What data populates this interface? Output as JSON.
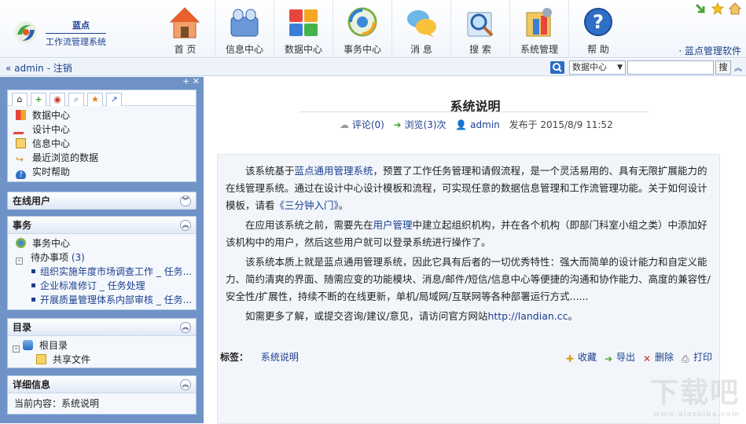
{
  "header": {
    "brand": "蓝点",
    "system_name": "工作流管理系统",
    "brand_link": "· 蓝点管理软件",
    "nav": [
      {
        "label": "首 页",
        "icon": "home-icon"
      },
      {
        "label": "信息中心",
        "icon": "info-center-icon"
      },
      {
        "label": "数据中心",
        "icon": "data-center-icon"
      },
      {
        "label": "事务中心",
        "icon": "task-center-icon"
      },
      {
        "label": "消 息",
        "icon": "message-icon"
      },
      {
        "label": "搜 索",
        "icon": "search-icon"
      },
      {
        "label": "系统管理",
        "icon": "system-admin-icon"
      },
      {
        "label": "帮 助",
        "icon": "help-icon"
      }
    ]
  },
  "toolbar": {
    "user": "admin",
    "logout": "注销",
    "search_scope": "数据中心",
    "search_value": "",
    "search_button": "搜"
  },
  "sidebar": {
    "quick_links": [
      {
        "label": "数据中心"
      },
      {
        "label": "设计中心"
      },
      {
        "label": "信息中心"
      },
      {
        "label": "最近浏览的数据"
      },
      {
        "label": "实时帮助"
      }
    ],
    "online_users": {
      "title": "在线用户"
    },
    "tasks": {
      "title": "事务",
      "center": "事务中心",
      "pending": "待办事项",
      "pending_count": "(3)",
      "items": [
        "组织实施年度市场调查工作 _ 任务...",
        "企业标准修订 _ 任务处理",
        "开展质量管理体系内部审核 _ 任务..."
      ]
    },
    "directory": {
      "title": "目录",
      "root": "根目录",
      "shared": "共享文件"
    },
    "details": {
      "title": "详细信息",
      "current": "当前内容：系统说明"
    }
  },
  "article": {
    "title": "系统说明",
    "comments": "评论(0)",
    "views": "浏览(3)次",
    "author": "admin",
    "published": "发布于 2015/8/9 11:52",
    "paragraphs": [
      [
        "该系统基于",
        "蓝点通用管理系统",
        "，预置了工作任务管理和请假流程，是一个灵活易用的、具有无限扩展能力的在线管理系统。通过在设计中心设计模板和流程，可实现任意的数据信息管理和工作流管理功能。关于如何设计模板，请看",
        "《三分钟入门》",
        "。"
      ],
      [
        "在应用该系统之前，需要先在",
        "用户管理",
        "中建立起组织机构，并在各个机构（即部门科室小组之类）中添加好该机构中的用户，然后这些用户就可以登录系统进行操作了。"
      ],
      [
        "该系统本质上就是蓝点通用管理系统，因此它具有后者的一切优秀特性：强大而简单的设计能力和自定义能力、简约清爽的界面、随需应变的功能模块、消息/邮件/短信/信息中心等便捷的沟通和协作能力、高度的兼容性/安全性/扩展性，持续不断的在线更新，单机/局域网/互联网等各种部署运行方式......"
      ],
      [
        "如需更多了解，或提交咨询/建议/意见，请访问官方网站",
        "http://landian.cc",
        "。"
      ]
    ],
    "tags_label": "标签：",
    "tag": "系统说明",
    "actions": [
      "收藏",
      "导出",
      "删除",
      "打印"
    ]
  },
  "watermark": {
    "text": "下载吧",
    "url": "www.xiazaiba.com"
  },
  "colors": {
    "accent": "#1b3f8f",
    "sidebar_bg": "#6f93c7"
  }
}
